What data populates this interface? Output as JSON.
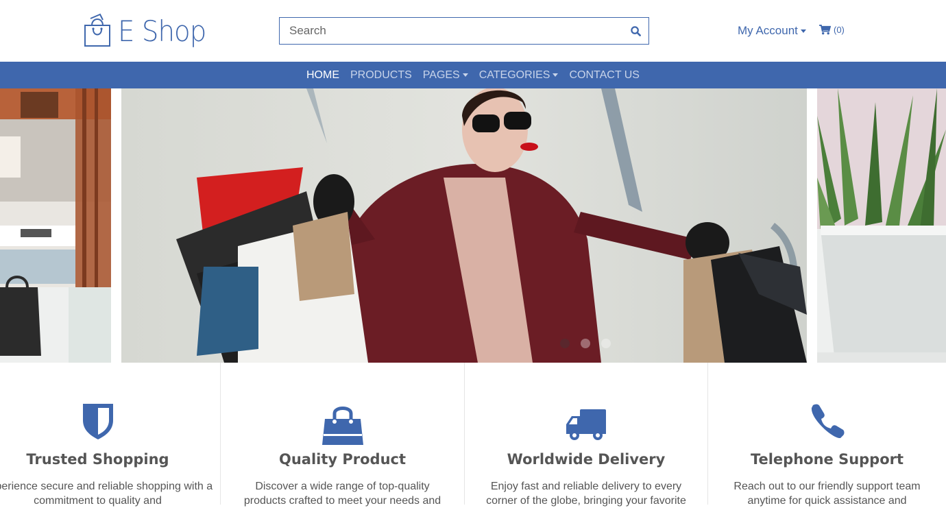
{
  "brand": {
    "name": "E Shop"
  },
  "search": {
    "placeholder": "Search"
  },
  "account": {
    "label": "My Account"
  },
  "cart": {
    "count": "(0)"
  },
  "nav": {
    "items": [
      {
        "label": "HOME",
        "active": true
      },
      {
        "label": "PRODUCTS"
      },
      {
        "label": "PAGES",
        "dropdown": true
      },
      {
        "label": "CATEGORIES",
        "dropdown": true
      },
      {
        "label": "CONTACT US"
      }
    ]
  },
  "carousel": {
    "slide_count": 3,
    "active_index": 0
  },
  "features": [
    {
      "icon": "shield-icon",
      "title": "Trusted Shopping",
      "text": "Experience secure and reliable shopping with a commitment to quality and"
    },
    {
      "icon": "shopping-bag-icon",
      "title": "Quality Product",
      "text": "Discover a wide range of top-quality products crafted to meet your needs and"
    },
    {
      "icon": "truck-icon",
      "title": "Worldwide Delivery",
      "text": "Enjoy fast and reliable delivery to every corner of the globe, bringing your favorite"
    },
    {
      "icon": "phone-icon",
      "title": "Telephone Support",
      "text": "Reach out to our friendly support team anytime for quick assistance and"
    }
  ],
  "colors": {
    "brand": "#3f67ad",
    "text": "#555555"
  }
}
